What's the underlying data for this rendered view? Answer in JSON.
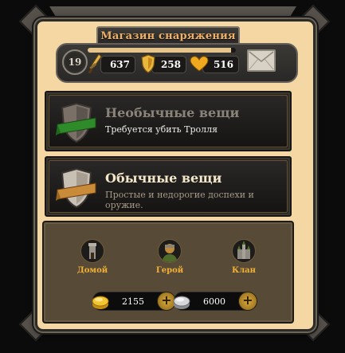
{
  "window": {
    "title": "Магазин снаряжения"
  },
  "player": {
    "level": "19",
    "xp_fraction": 0.97,
    "attack": "637",
    "defense": "258",
    "health": "516"
  },
  "shop_categories": [
    {
      "title": "Необычные вещи",
      "subtitle": "Требуется убить Тролля",
      "locked": true,
      "ribbon_color": "#2f8a2a"
    },
    {
      "title": "Обычные вещи",
      "subtitle": "Простые и недорогие доспехи и оружие.",
      "locked": false,
      "ribbon_color": "#c98a3a"
    }
  ],
  "navigation": {
    "home": "Домой",
    "hero": "Герой",
    "clan": "Клан"
  },
  "currency": {
    "gold": "2155",
    "silver": "6000"
  },
  "icons": {
    "attack": "sword-icon",
    "defense": "shield-icon",
    "health": "heart-icon",
    "mail": "mail-envelope-icon",
    "plus": "plus-icon"
  },
  "colors": {
    "accent_gold": "#f2b036",
    "panel_bg": "#f4d7a3",
    "title_text": "#f0b168"
  }
}
